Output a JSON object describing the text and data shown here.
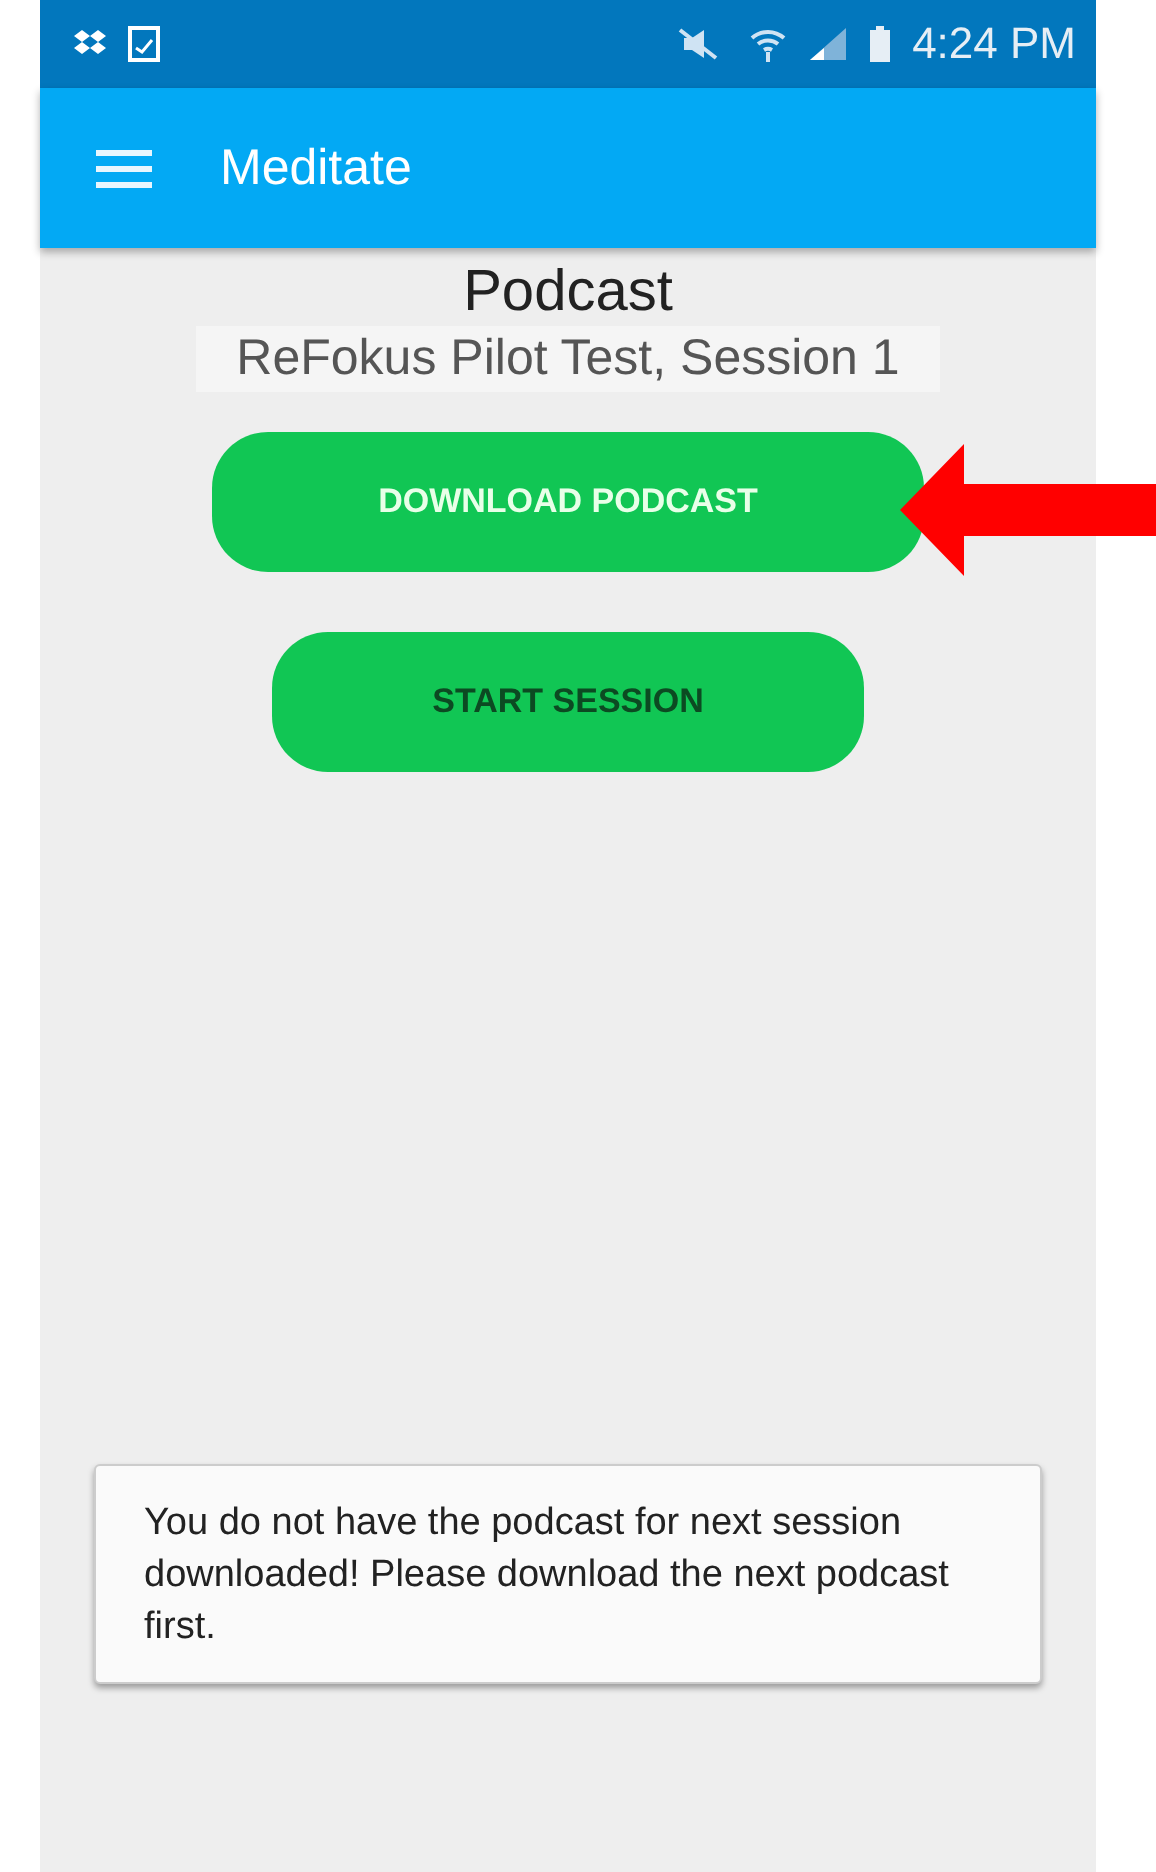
{
  "status_bar": {
    "time": "4:24 PM"
  },
  "app_bar": {
    "title": "Meditate"
  },
  "heading": "Podcast",
  "subtitle": "ReFokus Pilot Test, Session 1",
  "buttons": [
    {
      "label": "DOWNLOAD PODCAST",
      "kind": "primary"
    },
    {
      "label": "START SESSION",
      "kind": "secondary"
    }
  ],
  "toast": "You do not have the podcast for next session downloaded! Please download the next podcast first."
}
